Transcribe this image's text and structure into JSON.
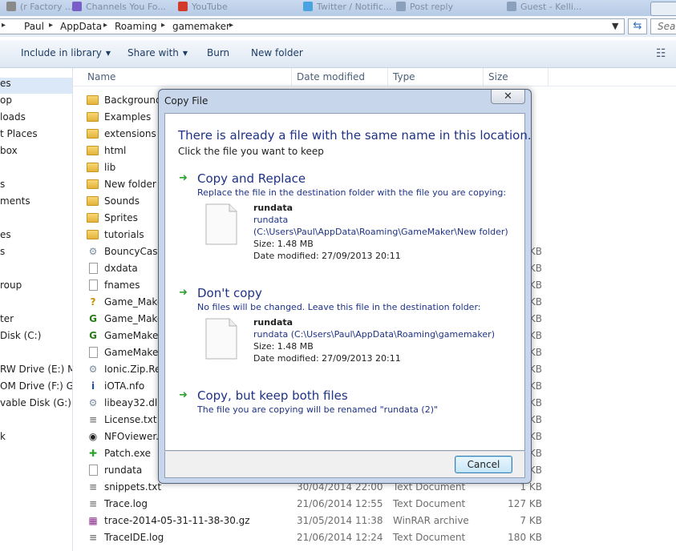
{
  "browser_tabs": [
    {
      "label": "(r Factory ...",
      "icon_color": "#8a8a8a"
    },
    {
      "label": "Channels You Fo...",
      "icon_color": "#7a5ec7"
    },
    {
      "label": "YouTube",
      "icon_color": "#d23a2a"
    },
    {
      "label": "Twitter / Notific...",
      "icon_color": "#4aa3df"
    },
    {
      "label": "Post reply",
      "icon_color": "#8aa0bd"
    },
    {
      "label": "Guest - Kelli...",
      "icon_color": "#8aa0bd"
    }
  ],
  "address": {
    "crumbs": [
      "Paul",
      "AppData",
      "Roaming",
      "gamemaker"
    ],
    "search_placeholder": "Sear"
  },
  "toolbar": {
    "include_label": "Include in library",
    "share_label": "Share with",
    "burn_label": "Burn",
    "new_folder_label": "New folder"
  },
  "nav": {
    "items": [
      "es",
      "op",
      "loads",
      "t Places",
      "box",
      "",
      "s",
      "ments",
      "",
      "es",
      "s",
      "",
      "roup",
      "",
      "ter",
      "Disk (C:)",
      "",
      "RW Drive (E:) MAF",
      "OM Drive (F:) Guit",
      "vable Disk (G:)",
      "",
      "k"
    ]
  },
  "columns": {
    "name": "Name",
    "date": "Date modified",
    "type": "Type",
    "size": "Size"
  },
  "files": [
    {
      "name": "Backgrounds",
      "icon": "folder",
      "date": "",
      "type": "",
      "size": ""
    },
    {
      "name": "Examples",
      "icon": "folder",
      "date": "",
      "type": "",
      "size": ""
    },
    {
      "name": "extensions",
      "icon": "folder",
      "date": "",
      "type": "",
      "size": ""
    },
    {
      "name": "html",
      "icon": "folder",
      "date": "",
      "type": "",
      "size": ""
    },
    {
      "name": "lib",
      "icon": "folder",
      "date": "",
      "type": "",
      "size": ""
    },
    {
      "name": "New folder",
      "icon": "folder",
      "date": "",
      "type": "",
      "size": ""
    },
    {
      "name": "Sounds",
      "icon": "folder",
      "date": "",
      "type": "",
      "size": ""
    },
    {
      "name": "Sprites",
      "icon": "folder",
      "date": "",
      "type": "",
      "size": ""
    },
    {
      "name": "tutorials",
      "icon": "folder",
      "date": "",
      "type": "",
      "size": ""
    },
    {
      "name": "BouncyCastl",
      "icon": "dll",
      "date": "",
      "type": "",
      "size": "KB"
    },
    {
      "name": "dxdata",
      "icon": "doc",
      "date": "",
      "type": "",
      "size": "KB"
    },
    {
      "name": "fnames",
      "icon": "doc",
      "date": "",
      "type": "",
      "size": "KB"
    },
    {
      "name": "Game_Maker",
      "icon": "gm-help",
      "date": "",
      "type": "",
      "size": "KB"
    },
    {
      "name": "Game_Maker",
      "icon": "gm",
      "date": "",
      "type": "",
      "size": "KB"
    },
    {
      "name": "GameMaker.",
      "icon": "gm",
      "date": "",
      "type": "",
      "size": "KB"
    },
    {
      "name": "GameMaker.",
      "icon": "doc",
      "date": "",
      "type": "",
      "size": "KB"
    },
    {
      "name": "Ionic.Zip.Rec",
      "icon": "dll",
      "date": "",
      "type": "",
      "size": "KB"
    },
    {
      "name": "iOTA.nfo",
      "icon": "nfo",
      "date": "",
      "type": "",
      "size": "KB"
    },
    {
      "name": "libeay32.dll",
      "icon": "dll",
      "date": "",
      "type": "",
      "size": "KB"
    },
    {
      "name": "License.txt",
      "icon": "txt",
      "date": "",
      "type": "",
      "size": "KB"
    },
    {
      "name": "NFOviewer.e",
      "icon": "nfoviewer",
      "date": "",
      "type": "",
      "size": "KB"
    },
    {
      "name": "Patch.exe",
      "icon": "patch",
      "date": "",
      "type": "",
      "size": "KB"
    },
    {
      "name": "rundata",
      "icon": "doc",
      "date": "",
      "type": "",
      "size": "KB"
    },
    {
      "name": "snippets.txt",
      "icon": "txt",
      "date": "30/04/2014 22:00",
      "type": "Text Document",
      "size": "1 KB"
    },
    {
      "name": "Trace.log",
      "icon": "txt",
      "date": "21/06/2014 12:55",
      "type": "Text Document",
      "size": "127 KB"
    },
    {
      "name": "trace-2014-05-31-11-38-30.gz",
      "icon": "rar",
      "date": "31/05/2014 11:38",
      "type": "WinRAR archive",
      "size": "7 KB"
    },
    {
      "name": "TraceIDE.log",
      "icon": "txt",
      "date": "21/06/2014 12:24",
      "type": "Text Document",
      "size": "180 KB"
    }
  ],
  "dialog": {
    "title": "Copy File",
    "close_glyph": "✕",
    "heading": "There is already a file with the same name in this location.",
    "subheading": "Click the file you want to keep",
    "options": [
      {
        "title": "Copy and Replace",
        "desc": "Replace the file in the destination folder with the file you are copying:",
        "file_name": "rundata",
        "path_lines": [
          "rundata",
          "(C:\\Users\\Paul\\AppData\\Roaming\\GameMaker\\New folder)"
        ],
        "size": "Size: 1.48 MB",
        "modified": "Date modified: 27/09/2013 20:11"
      },
      {
        "title": "Don't copy",
        "desc": "No files will be changed. Leave this file in the destination folder:",
        "file_name": "rundata",
        "path_lines": [
          "rundata (C:\\Users\\Paul\\AppData\\Roaming\\gamemaker)"
        ],
        "size": "Size: 1.48 MB",
        "modified": "Date modified: 27/09/2013 20:11"
      },
      {
        "title": "Copy, but keep both files",
        "desc": "The file you are copying will be renamed \"rundata (2)\""
      }
    ],
    "cancel_label": "Cancel"
  }
}
